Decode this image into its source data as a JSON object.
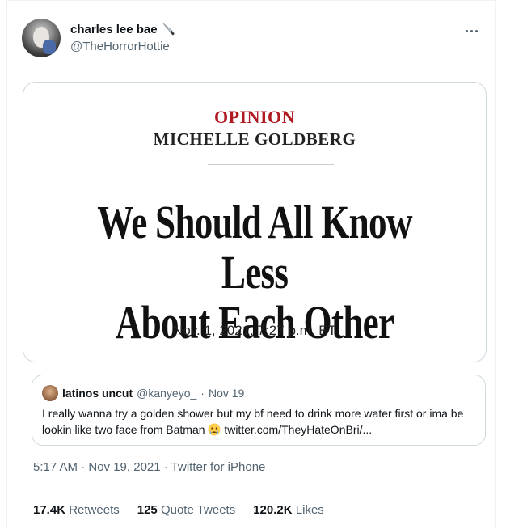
{
  "author": {
    "display_name": "charles lee bae",
    "handle": "@TheHorrorHottie",
    "name_emoji": "knife-icon"
  },
  "media_card": {
    "kicker": "OPINION",
    "byline": "MICHELLE GOLDBERG",
    "headline_line1": "We Should All Know Less",
    "headline_line2": "About Each Other",
    "date": "Nov. 1, 2021, 7:27 p.m. ET"
  },
  "quoted_tweet": {
    "display_name": "latinos uncut",
    "handle": "@kanyeyo_",
    "separator": "·",
    "date": "Nov 19",
    "text_part1": "I really wanna try a golden shower but my bf need to drink more water first or ima be lookin like two face from Batman",
    "emoji": "crying-face-icon",
    "link": "twitter.com/TheyHateOnBri/..."
  },
  "meta": {
    "timestamp": "5:17 AM · Nov 19, 2021 · Twitter for iPhone"
  },
  "stats": [
    {
      "value": "17.4K",
      "label": "Retweets"
    },
    {
      "value": "125",
      "label": "Quote Tweets"
    },
    {
      "value": "120.2K",
      "label": "Likes"
    }
  ],
  "colors": {
    "opinion_red": "#b01a22",
    "secondary_text": "#536471",
    "border": "#cfd9de"
  }
}
